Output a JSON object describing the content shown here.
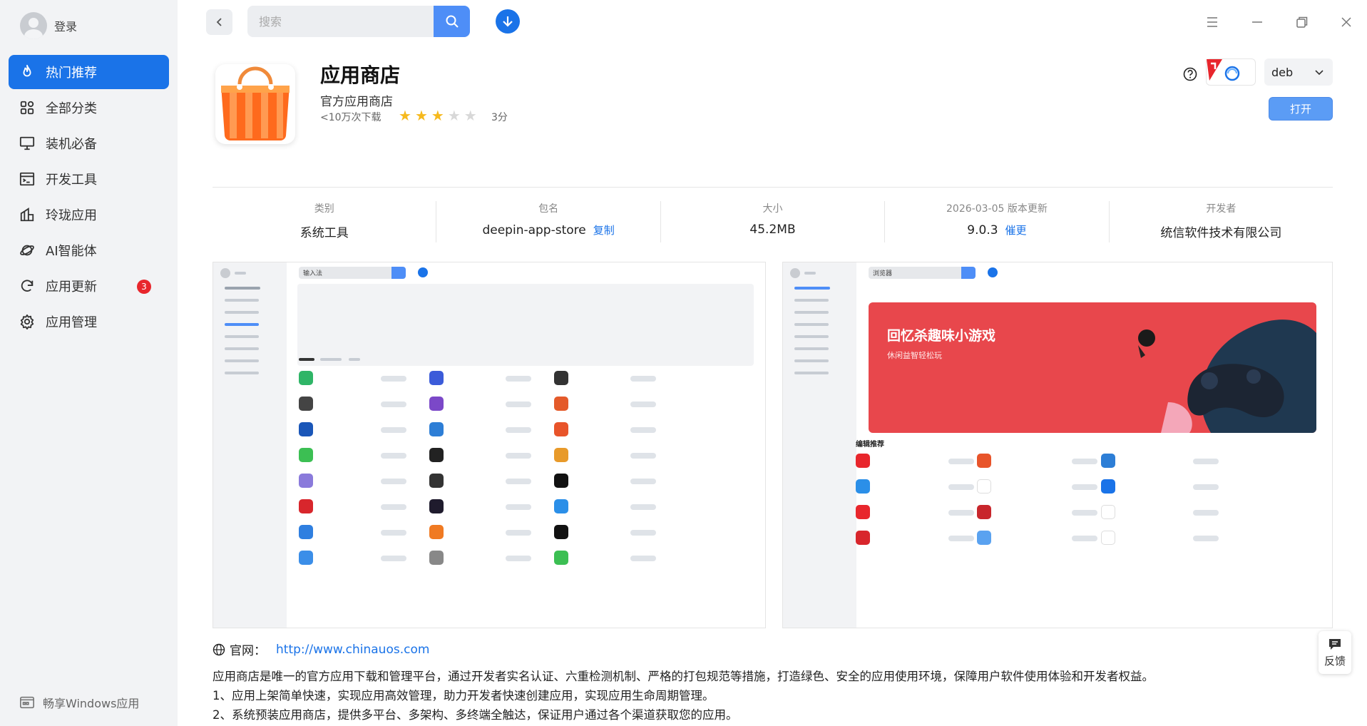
{
  "account": {
    "login_label": "登录"
  },
  "sidebar": {
    "items": [
      {
        "label": "热门推荐",
        "icon": "flame-icon",
        "active": true
      },
      {
        "label": "全部分类",
        "icon": "grid-icon"
      },
      {
        "label": "装机必备",
        "icon": "monitor-icon"
      },
      {
        "label": "开发工具",
        "icon": "terminal-icon"
      },
      {
        "label": "玲珑应用",
        "icon": "linglong-icon"
      },
      {
        "label": "AI智能体",
        "icon": "planet-icon"
      },
      {
        "label": "应用更新",
        "icon": "refresh-icon",
        "badge": "3"
      },
      {
        "label": "应用管理",
        "icon": "gear-icon"
      }
    ],
    "windows_link": "畅享Windows应用"
  },
  "topbar": {
    "search_placeholder": "搜索"
  },
  "app": {
    "name": "应用商店",
    "subtitle": "官方应用商店",
    "downloads": "<10万次下载",
    "rating_stars": 3,
    "rating_max": 5,
    "rating_text": "3分",
    "package_format": "deb",
    "open_label": "打开"
  },
  "info": {
    "category_label": "类别",
    "category_value": "系统工具",
    "package_label": "包名",
    "package_value": "deepin-app-store",
    "copy_label": "复制",
    "size_label": "大小",
    "size_value": "45.2MB",
    "update_label": "2026-03-05 版本更新",
    "version_value": "9.0.3",
    "urge_label": "催更",
    "developer_label": "开发者",
    "developer_value": "统信软件技术有限公司"
  },
  "screenshots": {
    "shot1_search": "输入法",
    "shot2_search": "浏览器",
    "shot2_banner_title": "回忆杀趣味小游戏",
    "shot2_banner_sub": "休闲益智轻松玩",
    "shot2_section": "编辑推荐"
  },
  "website": {
    "label": "官网：",
    "url": "http://www.chinauos.com"
  },
  "description": [
    "应用商店是唯一的官方应用下载和管理平台，通过开发者实名认证、六重检测机制、严格的打包规范等措施，打造绿色、安全的应用使用环境，保障用户软件使用体验和开发者权益。",
    "1、应用上架简单快速，实现应用高效管理，助力开发者快速创建应用，实现应用生命周期管理。",
    "2、系统预装应用商店，提供多平台、多架构、多终端全触达，保证用户通过各个渠道获取您的应用。"
  ],
  "feedback_label": "反馈",
  "colors": {
    "accent": "#1a73e8",
    "badge": "#e8262c",
    "star": "#f6b91d",
    "open_button": "#5b9cf5"
  }
}
